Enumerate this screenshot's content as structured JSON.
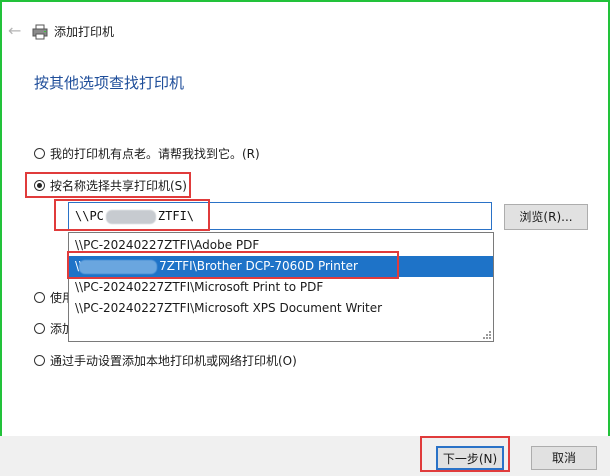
{
  "window": {
    "title": "添加打印机"
  },
  "page": {
    "heading": "按其他选项查找打印机"
  },
  "options": [
    {
      "label": "我的打印机有点老。请帮我找到它。(R)",
      "checked": false
    },
    {
      "label": "按名称选择共享打印机(S)",
      "checked": true
    },
    {
      "label": "使用",
      "checked": false
    },
    {
      "label": "添加",
      "checked": false
    },
    {
      "label": "通过手动设置添加本地打印机或网络打印机(O)",
      "checked": false
    }
  ],
  "share_input": {
    "prefix": "\\\\PC",
    "suffix": "ZTFI\\"
  },
  "browse_label": "浏览(R)...",
  "dropdown": {
    "items": [
      {
        "label": "\\\\PC-20240227ZTFI\\Adobe PDF"
      },
      {
        "prefix": "\\\\",
        "label": "7ZTFI\\Brother DCP-7060D Printer",
        "selected": true
      },
      {
        "label": "\\\\PC-20240227ZTFI\\Microsoft Print to PDF"
      },
      {
        "label": "\\\\PC-20240227ZTFI\\Microsoft XPS Document Writer"
      }
    ]
  },
  "buttons": {
    "next": "下一步(N)",
    "cancel": "取消"
  },
  "colors": {
    "highlight": "#e03b3b",
    "selection": "#1e73c8",
    "heading": "#1f4e9a",
    "frame": "#22c23a"
  }
}
